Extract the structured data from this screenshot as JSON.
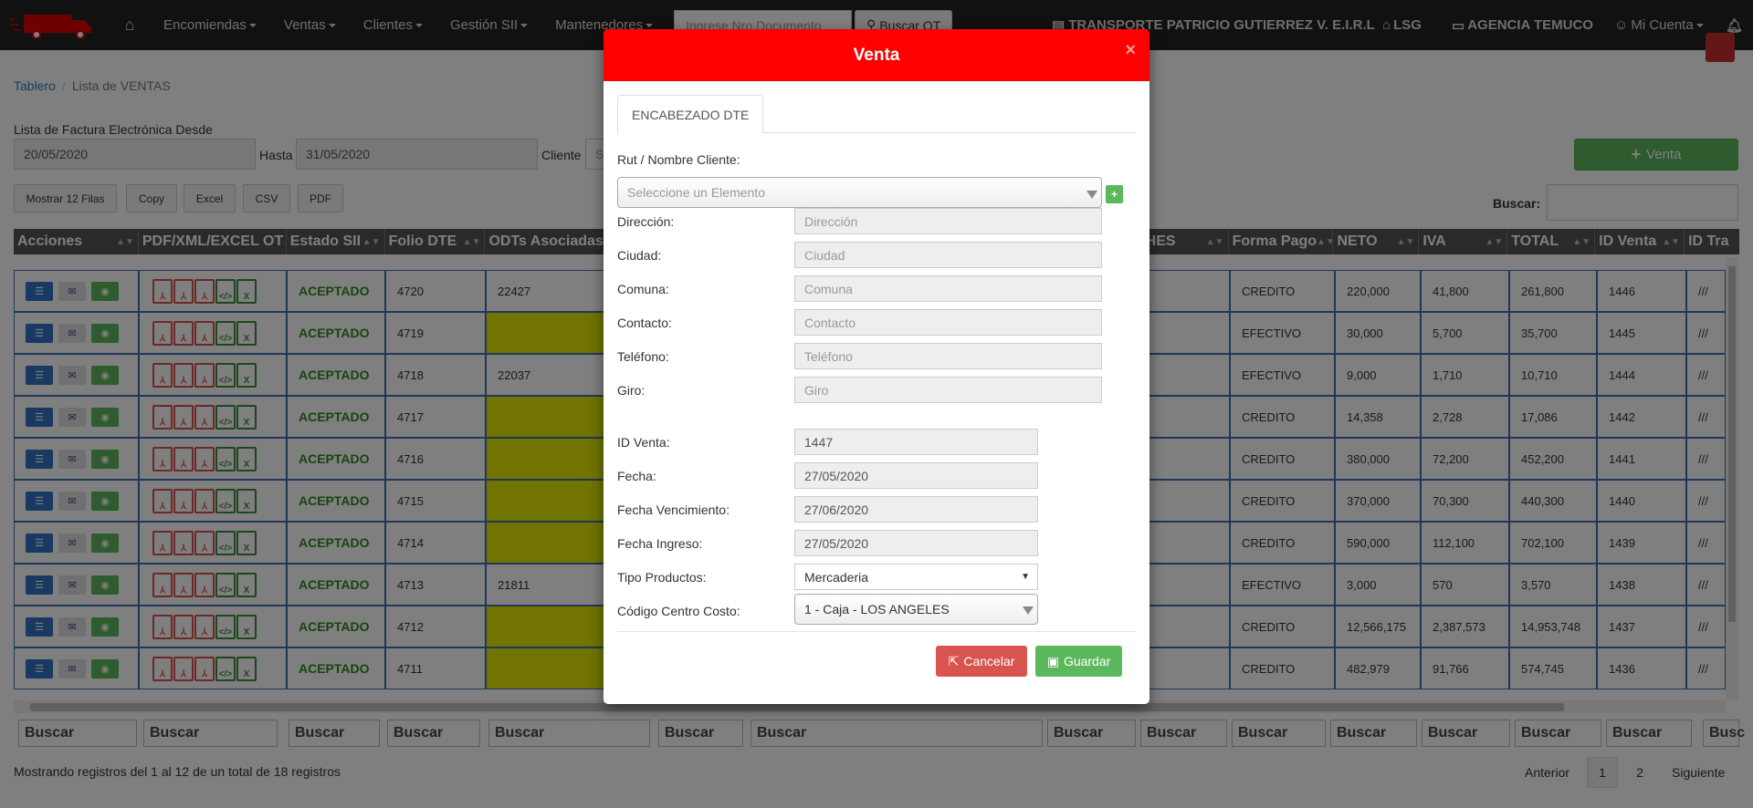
{
  "navbar": {
    "menus": [
      "Encomiendas",
      "Ventas",
      "Clientes",
      "Gestión SII",
      "Mantenedores"
    ],
    "search_placeholder": "Ingrese Nro.Documento",
    "search_button": "Buscar OT",
    "company": "TRANSPORTE PATRICIO GUTIERREZ V. E.I.R.L",
    "branch": "LSG",
    "agency": "AGENCIA TEMUCO",
    "account": "Mi Cuenta"
  },
  "breadcrumb": {
    "root": "Tablero",
    "current": "Lista de VENTAS"
  },
  "filters": {
    "title": "Lista de Factura Electrónica Desde",
    "from": "20/05/2020",
    "to_label": "Hasta",
    "to": "31/05/2020",
    "client_label": "Cliente",
    "client_placeholder": "S"
  },
  "new_sale_button": "Venta",
  "table_buttons": [
    "Mostrar 12 Filas",
    "Copy",
    "Excel",
    "CSV",
    "PDF"
  ],
  "search_label": "Buscar:",
  "columns": [
    "Acciones",
    "PDF/XML/EXCEL OT",
    "Estado SII",
    "Folio DTE",
    "ODTs Asociadas",
    "HES",
    "Forma Pago",
    "NETO",
    "IVA",
    "TOTAL",
    "ID Venta",
    "ID Tra"
  ],
  "rows": [
    {
      "estado": "ACEPTADO",
      "folio": "4720",
      "odt": "22427",
      "yellow": false,
      "forma": "CREDITO",
      "neto": "220,000",
      "iva": "41,800",
      "total": "261,800",
      "id": "1446",
      "tra": "///"
    },
    {
      "estado": "ACEPTADO",
      "folio": "4719",
      "odt": "",
      "yellow": true,
      "forma": "EFECTIVO",
      "neto": "30,000",
      "iva": "5,700",
      "total": "35,700",
      "id": "1445",
      "tra": "///"
    },
    {
      "estado": "ACEPTADO",
      "folio": "4718",
      "odt": "22037",
      "yellow": false,
      "forma": "EFECTIVO",
      "neto": "9,000",
      "iva": "1,710",
      "total": "10,710",
      "id": "1444",
      "tra": "///"
    },
    {
      "estado": "ACEPTADO",
      "folio": "4717",
      "odt": "",
      "yellow": true,
      "forma": "CREDITO",
      "neto": "14,358",
      "iva": "2,728",
      "total": "17,086",
      "id": "1442",
      "tra": "///"
    },
    {
      "estado": "ACEPTADO",
      "folio": "4716",
      "odt": "",
      "yellow": true,
      "forma": "CREDITO",
      "neto": "380,000",
      "iva": "72,200",
      "total": "452,200",
      "id": "1441",
      "tra": "///"
    },
    {
      "estado": "ACEPTADO",
      "folio": "4715",
      "odt": "",
      "yellow": true,
      "forma": "CREDITO",
      "neto": "370,000",
      "iva": "70,300",
      "total": "440,300",
      "id": "1440",
      "tra": "///"
    },
    {
      "estado": "ACEPTADO",
      "folio": "4714",
      "odt": "",
      "yellow": true,
      "forma": "CREDITO",
      "neto": "590,000",
      "iva": "112,100",
      "total": "702,100",
      "id": "1439",
      "tra": "///"
    },
    {
      "estado": "ACEPTADO",
      "folio": "4713",
      "odt": "21811",
      "yellow": false,
      "forma": "EFECTIVO",
      "neto": "3,000",
      "iva": "570",
      "total": "3,570",
      "id": "1438",
      "tra": "///"
    },
    {
      "estado": "ACEPTADO",
      "folio": "4712",
      "odt": "",
      "yellow": true,
      "forma": "CREDITO",
      "neto": "12,566,175",
      "iva": "2,387,573",
      "total": "14,953,748",
      "id": "1437",
      "tra": "///"
    },
    {
      "estado": "ACEPTADO",
      "folio": "4711",
      "odt": "",
      "yellow": true,
      "forma": "CREDITO",
      "neto": "482,979",
      "iva": "91,766",
      "total": "574,745",
      "id": "1436",
      "tra": "///"
    }
  ],
  "footer_search": "Buscar",
  "footer_search_last": "Busc",
  "info": "Mostrando registros del 1 al 12 de un total de 18 registros",
  "pagination": {
    "prev": "Anterior",
    "pages": [
      "1",
      "2"
    ],
    "next": "Siguiente"
  },
  "modal": {
    "title": "Venta",
    "close": "×",
    "tab": "ENCABEZADO DTE",
    "client_label": "Rut / Nombre Cliente:",
    "client_select": "Seleccione un Elemento",
    "plus": "+",
    "fields": [
      {
        "label": "Dirección:",
        "placeholder": "Dirección"
      },
      {
        "label": "Ciudad:",
        "placeholder": "Ciudad"
      },
      {
        "label": "Comuna:",
        "placeholder": "Comuna"
      },
      {
        "label": "Contacto:",
        "placeholder": "Contacto"
      },
      {
        "label": "Teléfono:",
        "placeholder": "Teléfono"
      },
      {
        "label": "Giro:",
        "placeholder": "Giro"
      }
    ],
    "fields2": [
      {
        "label": "ID Venta:",
        "value": "1447"
      },
      {
        "label": "Fecha:",
        "value": "27/05/2020"
      },
      {
        "label": "Fecha Vencimiento:",
        "value": "27/06/2020"
      },
      {
        "label": "Fecha Ingreso:",
        "value": "27/05/2020"
      }
    ],
    "tipo_label": "Tipo Productos:",
    "tipo_value": "Mercaderia",
    "centro_label": "Código Centro Costo:",
    "centro_value": "1 - Caja - LOS ANGELES",
    "cancel": "Cancelar",
    "save": "Guardar"
  }
}
